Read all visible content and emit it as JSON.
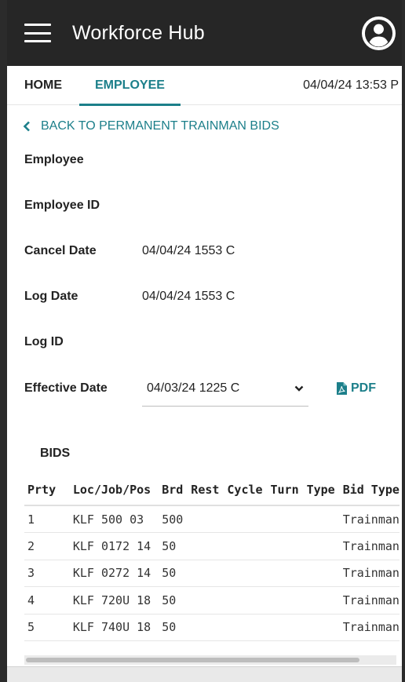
{
  "app": {
    "title": "Workforce Hub"
  },
  "tabs": {
    "home": "HOME",
    "employee": "EMPLOYEE"
  },
  "timestamp": "04/04/24 13:53 P",
  "back_link": "BACK TO PERMANENT TRAINMAN BIDS",
  "fields": {
    "employee": {
      "label": "Employee",
      "value": ""
    },
    "employee_id": {
      "label": "Employee ID",
      "value": ""
    },
    "cancel_date": {
      "label": "Cancel Date",
      "value": "04/04/24 1553 C"
    },
    "log_date": {
      "label": "Log Date",
      "value": "04/04/24 1553 C"
    },
    "log_id": {
      "label": "Log ID",
      "value": ""
    },
    "effective_date": {
      "label": "Effective Date",
      "value": "04/03/24 1225 C"
    }
  },
  "pdf_label": "PDF",
  "bids": {
    "title": "BIDS",
    "columns": [
      "Prty",
      "Loc/Job/Pos",
      "Brd",
      "Rest",
      "Cycle",
      "Turn",
      "Type",
      "Bid Type"
    ],
    "rows": [
      [
        "1",
        "KLF 500 03",
        "500",
        "",
        "",
        "",
        "",
        "Trainman"
      ],
      [
        "2",
        "KLF 0172 14",
        "50",
        "",
        "",
        "",
        "",
        "Trainman"
      ],
      [
        "3",
        "KLF 0272 14",
        "50",
        "",
        "",
        "",
        "",
        "Trainman"
      ],
      [
        "4",
        "KLF 720U 18",
        "50",
        "",
        "",
        "",
        "",
        "Trainman"
      ],
      [
        "5",
        "KLF 740U 18",
        "50",
        "",
        "",
        "",
        "",
        "Trainman"
      ]
    ]
  },
  "colors": {
    "accent": "#1c7f8a",
    "topbar": "#262626"
  },
  "icons": {
    "menu": "menu-icon",
    "account": "account-circle-icon",
    "back": "chevron-left-icon",
    "dropdown": "chevron-down-icon",
    "pdf": "pdf-file-icon"
  }
}
